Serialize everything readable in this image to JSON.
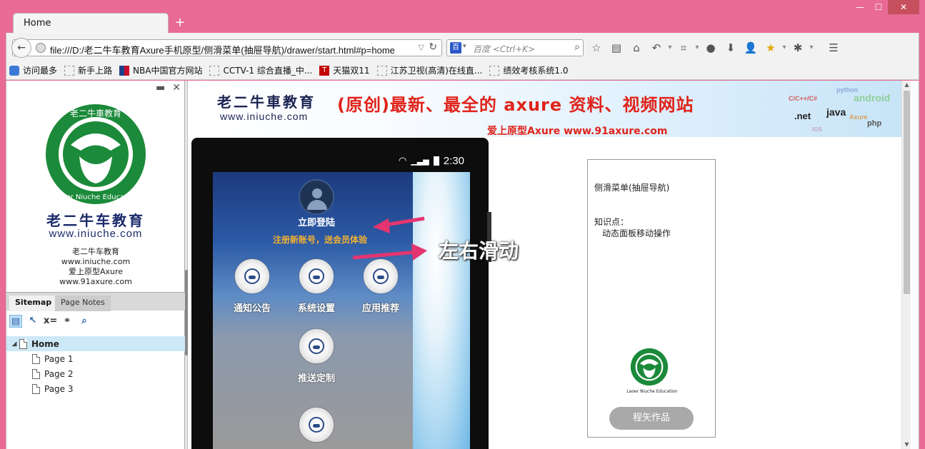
{
  "browser": {
    "tab_title": "Home",
    "new_tab": "+",
    "window_buttons": [
      "—",
      "☐",
      "✕"
    ],
    "url": "file:///D:/老二牛车教育Axure手机原型/侧滑菜单(抽屉导航)/drawer/start.html#p=home",
    "search_engine_icon": "baidu-icon",
    "search_placeholder": "百度 <Ctrl+K>"
  },
  "bookmarks": [
    {
      "label": "访问最多",
      "icon": "star"
    },
    {
      "label": "新手上路",
      "icon": "page"
    },
    {
      "label": "NBA中国官方网站",
      "icon": "nba"
    },
    {
      "label": "CCTV-1 综合直播_中...",
      "icon": "page"
    },
    {
      "label": "天猫双11",
      "icon": "tmall"
    },
    {
      "label": "江苏卫视(高清)在线直...",
      "icon": "page"
    },
    {
      "label": "绩效考核系统1.0",
      "icon": "page"
    }
  ],
  "sidebar": {
    "brand_title": "老二牛车教育",
    "brand_url": "www.iniuche.com",
    "brand_lines": [
      "老二牛车教育",
      "www.iniuche.com",
      "爱上原型Axure",
      "www.91axure.com"
    ],
    "logo_ring_text": "Laoer Niuche Education",
    "logo_top_text": "老二牛車教育",
    "tabs": [
      "Sitemap",
      "Page Notes"
    ],
    "tree": [
      {
        "label": "Home",
        "selected": true,
        "level": 0
      },
      {
        "label": "Page 1",
        "selected": false,
        "level": 1
      },
      {
        "label": "Page 2",
        "selected": false,
        "level": 1
      },
      {
        "label": "Page 3",
        "selected": false,
        "level": 1
      }
    ]
  },
  "banner": {
    "title": "老二牛車教育",
    "url": "www.iniuche.com",
    "slogan": "(原创)最新、最全的 axure 资料、视频网站",
    "sub": "爱上原型Axure  www.91axure.com",
    "words": [
      "C/C++/C#",
      "python",
      "android",
      ".net",
      "java",
      "Axure",
      "php",
      "IOS"
    ]
  },
  "phone": {
    "time": "2:30",
    "login": "立即登陆",
    "register": "注册新账号，送会员体验",
    "menu": [
      "通知公告",
      "系统设置",
      "应用推荐",
      "推送定制"
    ],
    "annotation": "左右滑动"
  },
  "card": {
    "title": "侧滑菜单(抽屉导航)",
    "kp_label": "知识点：",
    "kp_item": "动态面板移动操作",
    "logo_caption": "Laoer Niuche Education",
    "button": "程矢作品"
  }
}
